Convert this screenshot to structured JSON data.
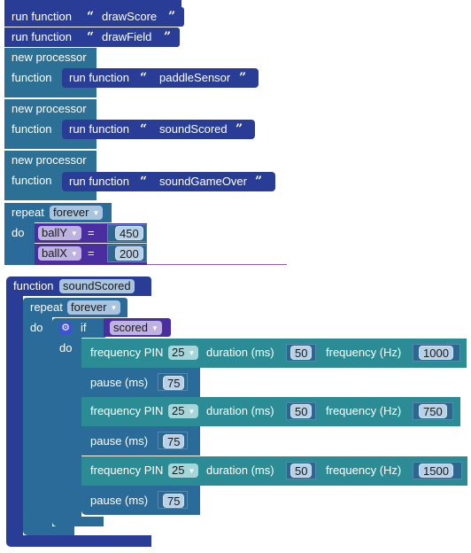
{
  "stack1": {
    "run_calls": [
      {
        "label": "run function",
        "name": "drawScore"
      },
      {
        "label": "run function",
        "name": "drawField"
      }
    ],
    "processors": [
      {
        "title": "new processor",
        "function_label": "function",
        "run_label": "run function",
        "name": "paddleSensor"
      },
      {
        "title": "new processor",
        "function_label": "function",
        "run_label": "run function",
        "name": "soundScored"
      },
      {
        "title": "new processor",
        "function_label": "function",
        "run_label": "run function",
        "name": "soundGameOver"
      }
    ],
    "repeat": {
      "label": "repeat",
      "mode": "forever",
      "do_label": "do",
      "assignments": [
        {
          "var": "ballY",
          "op": "=",
          "value": "450"
        },
        {
          "var": "ballX",
          "op": "=",
          "value": "200"
        }
      ]
    }
  },
  "stack2": {
    "function_label": "function",
    "function_name": "soundScored",
    "repeat": {
      "label": "repeat",
      "mode": "forever",
      "do_label": "do"
    },
    "if_block": {
      "if_label": "if",
      "condition_var": "scored",
      "do_label": "do"
    },
    "steps": [
      {
        "type": "frequency",
        "pin_label": "frequency PIN",
        "pin": "25",
        "duration_label": "duration (ms)",
        "duration": "50",
        "freq_label": "frequency (Hz)",
        "freq": "1000"
      },
      {
        "type": "pause",
        "label": "pause (ms)",
        "value": "75"
      },
      {
        "type": "frequency",
        "pin_label": "frequency PIN",
        "pin": "25",
        "duration_label": "duration (ms)",
        "duration": "50",
        "freq_label": "frequency (Hz)",
        "freq": "750"
      },
      {
        "type": "pause",
        "label": "pause (ms)",
        "value": "75"
      },
      {
        "type": "frequency",
        "pin_label": "frequency PIN",
        "pin": "25",
        "duration_label": "duration (ms)",
        "duration": "50",
        "freq_label": "frequency (Hz)",
        "freq": "1500"
      },
      {
        "type": "pause",
        "label": "pause (ms)",
        "value": "75"
      }
    ]
  },
  "icons": {
    "open_quote": "“",
    "close_quote": "”",
    "dropdown": "▼",
    "gear": "⚙"
  }
}
